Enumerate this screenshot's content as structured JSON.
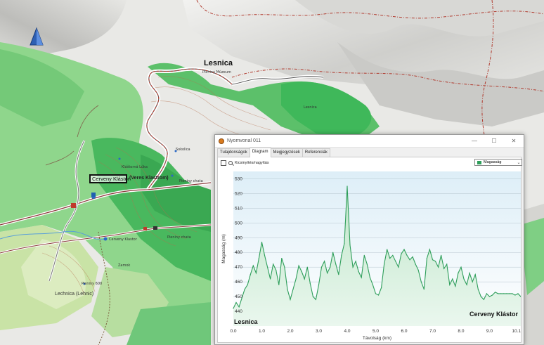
{
  "map": {
    "towns": {
      "lesnica": "Lesnica",
      "lechnica": "Lechnica (Lehnic)"
    },
    "cerveny_label": "Cerveny Klástor",
    "cerveny_label_suffix": "(Veres Klastrom)",
    "small_labels": [
      "Pieniny Múzeum",
      "Kláštorná Lúka",
      "Pieniny chata",
      "Lesnica",
      "Pieniny chata",
      "Sokolica",
      "Pieniny 600",
      "Cerveny Klastor",
      "Zamok"
    ]
  },
  "window": {
    "title": "Nyomvonal 011",
    "buttons": {
      "minimize": "—",
      "maximize": "☐",
      "close": "✕"
    },
    "tabs": [
      "Tulajdonságok",
      "Diagram",
      "Megjegyzések",
      "Referenciák"
    ],
    "active_tab": 1,
    "zoom_label": "Kicsinyítés/nagyítás",
    "series_select": "Magasság",
    "series_color": "#2e9e5a"
  },
  "chart_data": {
    "type": "area",
    "xlabel": "Távolság (km)",
    "ylabel": "Magasság (m)",
    "xlim": [
      0.0,
      10.1
    ],
    "ylim": [
      430,
      535
    ],
    "xticks": [
      "0.0",
      "1.0",
      "2.0",
      "3.0",
      "4.0",
      "5.0",
      "6.0",
      "7.0",
      "8.0",
      "9.0",
      "10.1"
    ],
    "yticks": [
      440,
      450,
      460,
      470,
      480,
      490,
      500,
      510,
      520,
      530
    ],
    "grid": true,
    "annotations": {
      "start": "Lesnica",
      "end": "Cerveny Klástor"
    },
    "series": [
      {
        "x": [
          0.0,
          0.1,
          0.2,
          0.3,
          0.4,
          0.5,
          0.6,
          0.7,
          0.8,
          0.9,
          1.0,
          1.1,
          1.2,
          1.3,
          1.4,
          1.5,
          1.6,
          1.7,
          1.8,
          1.9,
          2.0,
          2.1,
          2.2,
          2.3,
          2.4,
          2.5,
          2.6,
          2.7,
          2.8,
          2.9,
          3.0,
          3.1,
          3.2,
          3.3,
          3.4,
          3.5,
          3.6,
          3.7,
          3.8,
          3.9,
          4.0,
          4.1,
          4.2,
          4.3,
          4.4,
          4.5,
          4.6,
          4.7,
          4.8,
          4.9,
          5.0,
          5.1,
          5.2,
          5.3,
          5.4,
          5.5,
          5.6,
          5.7,
          5.8,
          5.9,
          6.0,
          6.1,
          6.2,
          6.3,
          6.4,
          6.5,
          6.6,
          6.7,
          6.8,
          6.9,
          7.0,
          7.1,
          7.2,
          7.3,
          7.4,
          7.5,
          7.6,
          7.7,
          7.8,
          7.9,
          8.0,
          8.1,
          8.2,
          8.3,
          8.4,
          8.5,
          8.6,
          8.7,
          8.8,
          8.9,
          9.0,
          9.1,
          9.2,
          9.3,
          9.4,
          9.5,
          9.6,
          9.7,
          9.8,
          9.9,
          10.0,
          10.1
        ],
        "values": [
          442,
          446,
          443,
          449,
          455,
          458,
          465,
          471,
          466,
          476,
          487,
          478,
          470,
          462,
          472,
          468,
          458,
          476,
          470,
          455,
          448,
          455,
          462,
          471,
          467,
          462,
          470,
          459,
          450,
          448,
          458,
          470,
          474,
          466,
          470,
          480,
          472,
          465,
          478,
          486,
          525,
          485,
          470,
          474,
          467,
          463,
          478,
          472,
          463,
          458,
          452,
          451,
          456,
          472,
          482,
          476,
          478,
          474,
          470,
          479,
          482,
          478,
          475,
          477,
          472,
          468,
          460,
          455,
          476,
          482,
          475,
          474,
          470,
          478,
          469,
          472,
          458,
          462,
          457,
          466,
          470,
          462,
          458,
          466,
          460,
          465,
          455,
          450,
          448,
          452,
          450,
          451,
          453,
          452,
          452,
          452,
          452,
          452,
          452,
          451,
          452,
          450
        ]
      }
    ]
  }
}
